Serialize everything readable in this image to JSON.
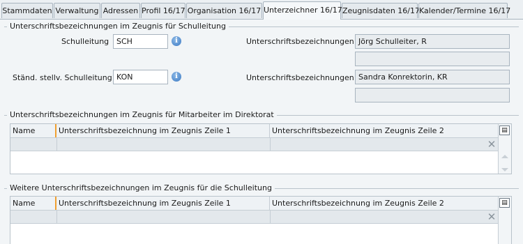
{
  "tabs": [
    {
      "label": "Stammdaten"
    },
    {
      "label": "Verwaltung"
    },
    {
      "label": "Adressen"
    },
    {
      "label": "Profil 16/17"
    },
    {
      "label": "Organisation 16/17"
    },
    {
      "label": "Unterzeichner 16/17"
    },
    {
      "label": "Zeugnisdaten 16/17"
    },
    {
      "label": "Kalender/Termine 16/17"
    }
  ],
  "section1": {
    "title": "Unterschriftsbezeichnungen im Zeugnis für Schulleitung",
    "schulleitung_label": "Schulleitung",
    "schulleitung_value": "SCH",
    "sig_label_1": "Unterschriftsbezeichnungen",
    "sig_value_1": "Jörg Schulleiter, R",
    "sig_value_1b": "",
    "stellv_label": "Ständ. stellv. Schulleitung",
    "stellv_value": "KON",
    "sig_label_2": "Unterschriftsbezeichnungen",
    "sig_value_2": "Sandra Konrektorin, KR",
    "sig_value_2b": ""
  },
  "section2": {
    "title": "Unterschriftsbezeichnungen im Zeugnis für Mitarbeiter im Direktorat",
    "columns": [
      "Name",
      "Unterschriftsbezeichnung im Zeugnis Zeile 1",
      "Unterschriftsbezeichnung im Zeugnis Zeile 2"
    ]
  },
  "section3": {
    "title": "Weitere Unterschriftsbezeichnungen im Zeugnis für die Schulleitung",
    "columns": [
      "Name",
      "Unterschriftsbezeichnung im Zeugnis Zeile 1",
      "Unterschriftsbezeichnung im Zeugnis Zeile 2"
    ]
  },
  "icons": {
    "info": "info-icon",
    "grid_menu": "grid-menu-icon",
    "clear_filter": "clear-filter-icon",
    "scroll_up": "scroll-up-icon",
    "scroll_down": "scroll-down-icon"
  }
}
